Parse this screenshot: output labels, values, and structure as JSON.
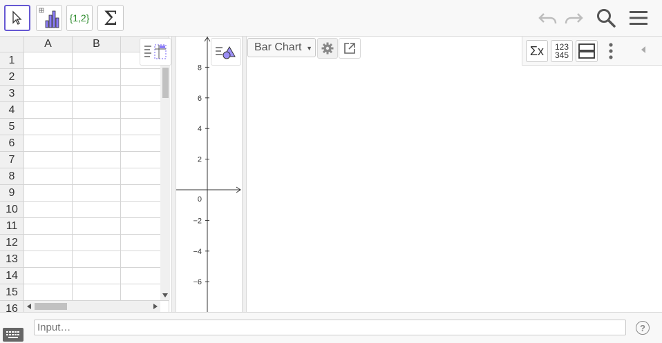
{
  "toolbar": {
    "tools": [
      {
        "name": "move-tool",
        "icon": "arrow-cursor-icon",
        "selected": true
      },
      {
        "name": "two-variable-tool",
        "icon": "bar-chart-icon",
        "selected": false
      },
      {
        "name": "create-list-tool",
        "icon": "list-icon",
        "label": "{1,2}",
        "selected": false
      },
      {
        "name": "sum-tool",
        "icon": "sigma-icon",
        "label": "Σ",
        "selected": false
      }
    ],
    "right": [
      "undo-icon",
      "redo-icon",
      "search-icon",
      "menu-icon"
    ],
    "accent": "#6557d2"
  },
  "spreadsheet": {
    "columns": [
      "A",
      "B",
      ""
    ],
    "rows": [
      "1",
      "2",
      "3",
      "4",
      "5",
      "6",
      "7",
      "8",
      "9",
      "10",
      "11",
      "12",
      "13",
      "14",
      "15",
      "16"
    ]
  },
  "graphics": {
    "y_ticks": [
      "8",
      "6",
      "4",
      "2",
      "0",
      "−2",
      "−4",
      "−6"
    ]
  },
  "analysis": {
    "chart_type": "Bar Chart",
    "tools": [
      "sigma-x-icon",
      "data-123-icon",
      "layout-icon",
      "more-vert-icon",
      "collapse-left-icon"
    ],
    "sigma_label": "Σx",
    "data_label_top": "123",
    "data_label_bottom": "345"
  },
  "inputbar": {
    "placeholder": "Input…",
    "help": "?"
  }
}
